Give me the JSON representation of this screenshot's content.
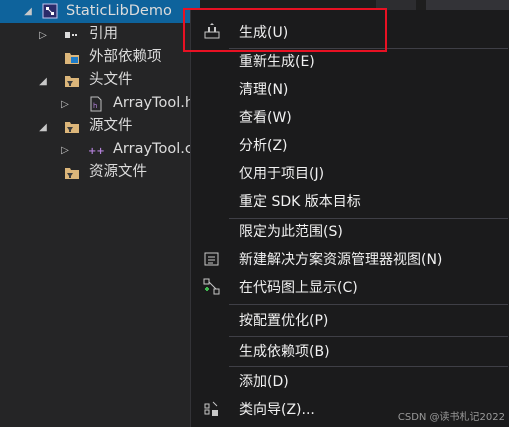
{
  "tree": {
    "project": "StaticLibDemo",
    "items": [
      {
        "label": "引用",
        "icon": "references-icon"
      },
      {
        "label": "外部依赖项",
        "icon": "external-deps-icon"
      },
      {
        "label": "头文件",
        "icon": "folder-filter-icon"
      },
      {
        "label": "ArrayTool.h",
        "icon": "header-file-icon"
      },
      {
        "label": "源文件",
        "icon": "folder-filter-icon"
      },
      {
        "label": "ArrayTool.c",
        "icon": "cpp-file-icon"
      },
      {
        "label": "资源文件",
        "icon": "folder-filter-icon"
      }
    ],
    "project_visible": "StaticLibDemo",
    "header_visible": "ArrayTool.h",
    "source_visible": "ArrayTool.c"
  },
  "menu": {
    "items": [
      {
        "label": "生成(U)",
        "icon": "build-icon"
      },
      {
        "label": "重新生成(E)"
      },
      {
        "label": "清理(N)"
      },
      {
        "label": "查看(W)"
      },
      {
        "label": "分析(Z)"
      },
      {
        "label": "仅用于项目(J)"
      },
      {
        "label": "重定 SDK 版本目标"
      },
      {
        "label": "限定为此范围(S)"
      },
      {
        "label": "新建解决方案资源管理器视图(N)",
        "icon": "new-view-icon"
      },
      {
        "label": "在代码图上显示(C)",
        "icon": "code-map-icon"
      },
      {
        "label": "按配置优化(P)"
      },
      {
        "label": "生成依赖项(B)"
      },
      {
        "label": "添加(D)"
      },
      {
        "label": "类向导(Z)...",
        "icon": "class-wizard-icon"
      }
    ]
  },
  "watermark": "CSDN @读书札记2022",
  "colors": {
    "selection": "#0e639c",
    "menu_bg": "#1b1b1c",
    "highlight_border": "#e81123",
    "folder": "#dcb67a"
  }
}
